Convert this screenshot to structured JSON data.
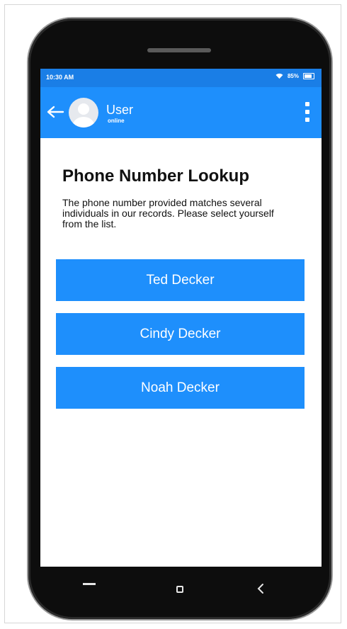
{
  "status_bar": {
    "time": "10:30 AM",
    "battery": "85%"
  },
  "header": {
    "user_name": "User",
    "user_status": "online"
  },
  "main": {
    "title": "Phone Number Lookup",
    "description": "The phone number provided matches several individuals in our records. Please select yourself from the list.",
    "people": [
      "Ted Decker",
      "Cindy Decker",
      "Noah Decker"
    ]
  },
  "icons": {
    "back": "arrow-left-icon",
    "avatar": "user-avatar",
    "menu": "more-vertical-icon",
    "wifi": "wifi-icon",
    "battery": "battery-icon",
    "nav_recent": "recent-apps-icon",
    "nav_home": "home-square-icon",
    "nav_back": "chevron-left-icon"
  },
  "colors": {
    "accent": "#1e8ffc",
    "status_bar": "#1a7ee6",
    "phone_body": "#0d0d0d"
  }
}
